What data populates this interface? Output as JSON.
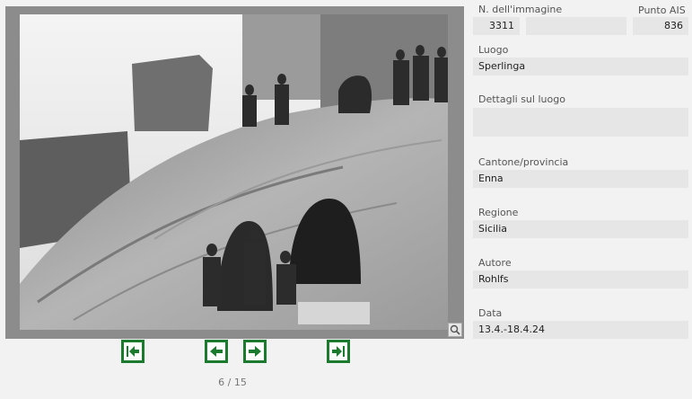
{
  "navigation": {
    "counter": "6 / 15",
    "first_icon": "first-page-icon",
    "prev_icon": "previous-arrow-icon",
    "next_icon": "next-arrow-icon",
    "last_icon": "last-page-icon",
    "zoom_icon": "magnifier-icon",
    "accent_color": "#1c7a2f"
  },
  "details": {
    "image_number_label": "N. dell'immagine",
    "image_number": "3311",
    "ais_point_label": "Punto AIS",
    "ais_point": "836",
    "place_label": "Luogo",
    "place": "Sperlinga",
    "place_details_label": "Dettagli sul luogo",
    "place_details": "",
    "canton_label": "Cantone/provincia",
    "canton": "Enna",
    "region_label": "Regione",
    "region": "Sicilia",
    "author_label": "Autore",
    "author": "Rohlfs",
    "date_label": "Data",
    "date": "13.4.-18.4.24"
  }
}
